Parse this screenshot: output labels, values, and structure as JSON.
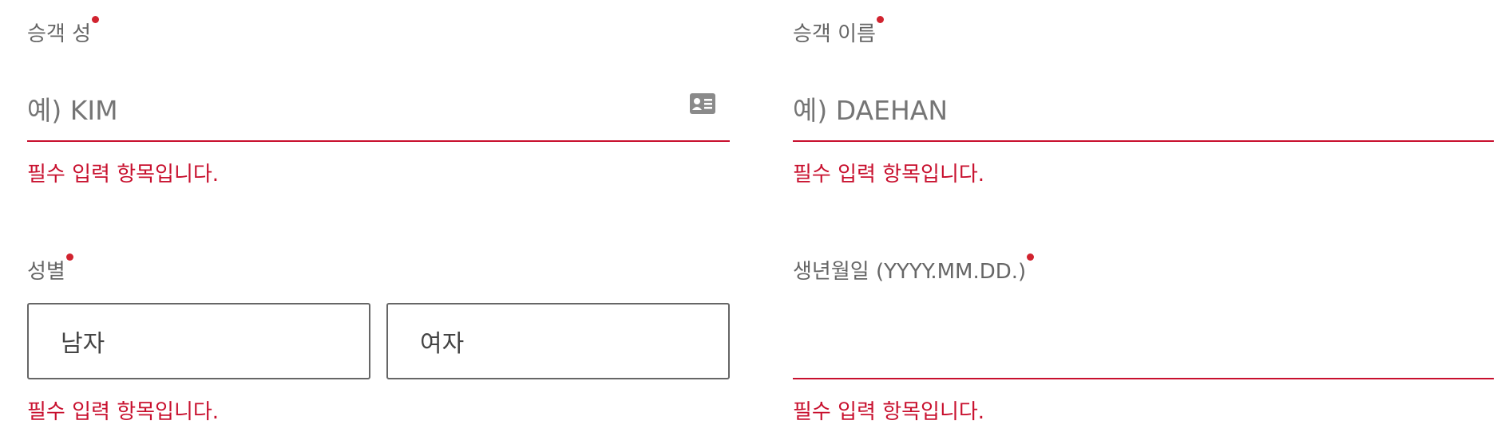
{
  "last_name": {
    "label": "승객 성",
    "placeholder": "예) KIM",
    "value": "",
    "error": "필수 입력 항목입니다.",
    "icon": "id-card-icon"
  },
  "first_name": {
    "label": "승객 이름",
    "placeholder": "예) DAEHAN",
    "value": "",
    "error": "필수 입력 항목입니다."
  },
  "gender": {
    "label": "성별",
    "options": [
      "남자",
      "여자"
    ],
    "error": "필수 입력 항목입니다."
  },
  "birthdate": {
    "label": "생년월일 (YYYY.MM.DD.)",
    "placeholder": "",
    "value": "",
    "error": "필수 입력 항목입니다."
  },
  "colors": {
    "error": "#c8102e",
    "required_dot": "#d1232f",
    "label": "#666666",
    "placeholder": "#757575"
  }
}
